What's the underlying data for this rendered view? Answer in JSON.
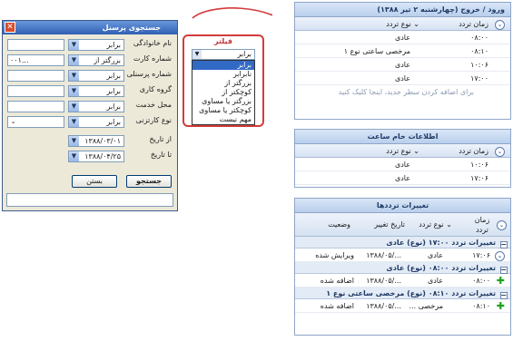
{
  "entry": {
    "title": "ورود / خروج (چهارشنبه ۲ تیر ۱۳۸۸)",
    "col_time": "زمان تردد",
    "col_type": "نوع تردد",
    "rows": [
      {
        "time": "۰۸:۰۰",
        "type": "عادی"
      },
      {
        "time": "۰۸:۱۰",
        "type": "مرخصی ساعتی نوع ۱"
      },
      {
        "time": "۱۰:۰۶",
        "type": "عادی"
      },
      {
        "time": "۱۷:۰۰",
        "type": "عادی"
      }
    ],
    "hint": "برای اضافه کردن سطر جدید، اینجا کلیک کنید"
  },
  "raw": {
    "title": "اطلاعات خام ساعت",
    "col_time": "زمان تردد",
    "col_type": "نوع تردد",
    "rows": [
      {
        "time": "۱۰:۰۶",
        "type": "عادی"
      },
      {
        "time": "۱۷:۰۶",
        "type": "عادی"
      }
    ]
  },
  "changes": {
    "title": "تغییرات ترددها",
    "col_time": "زمان تردد",
    "col_type": "نوع تردد",
    "col_date": "تاریخ تغییر",
    "col_status": "وضعیت",
    "groups": [
      {
        "label": "تغییرات تردد ۱۷:۰۰ (نوع) عادی",
        "time": "۱۷:۰۶",
        "type": "عادی",
        "date": "۱۳۸۸/۰۵/...",
        "status": "ویرایش شده"
      },
      {
        "label": "تغییرات تردد ۰۸:۰۰ (نوع) عادی",
        "time": "۰۸:۰۰",
        "type": "عادی",
        "date": "۱۳۸۸/۰۵/...",
        "status": "اضافه شده"
      },
      {
        "label": "تغییرات تردد ۰۸:۱۰ (نوع) مرخصی ساعتی نوع ۱",
        "time": "۰۸:۱۰",
        "type": "مرخصی ...",
        "date": "۱۳۸۸/۰۵/...",
        "status": "اضافه شده"
      }
    ]
  },
  "dialog": {
    "title": "جستجوی پرسنل",
    "fields": [
      {
        "label": "نام خانوادگی",
        "op": "برابر",
        "value": ""
      },
      {
        "label": "شماره کارت",
        "op": "بزرگتر از",
        "value": "۰۰۱..."
      },
      {
        "label": "شماره پرسنلی",
        "op": "برابر",
        "value": ""
      },
      {
        "label": "گروه کاری",
        "op": "برابر",
        "value": ""
      },
      {
        "label": "محل خدمت",
        "op": "برابر",
        "value": ""
      },
      {
        "label": "نوع کارتزنی",
        "op": "برابر",
        "value": ""
      }
    ],
    "from_label": "از تاریخ",
    "from_value": "۱۳۸۸/۰۳/۰۱",
    "to_label": "تا تاریخ",
    "to_value": "۱۳۸۸/۰۴/۲۵",
    "search_btn": "جستجو",
    "close_btn": "بستن"
  },
  "filter": {
    "title": "فیلتر",
    "current": "برابر",
    "options": [
      "برابر",
      "نابرابر",
      "بزرگتر از",
      "کوچکتر از",
      "بزرگتر یا مساوی",
      "کوچکتر یا مساوی",
      "مهم نیست"
    ]
  }
}
